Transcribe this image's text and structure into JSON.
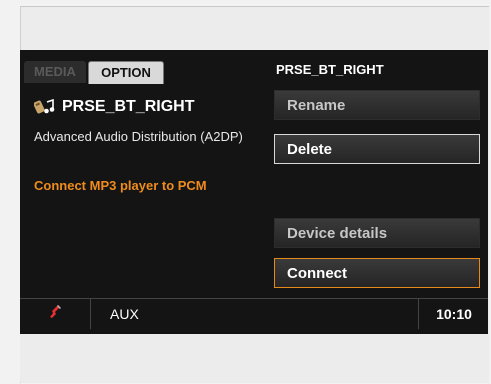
{
  "tabs": [
    {
      "label": "MEDIA",
      "active": false
    },
    {
      "label": "OPTION",
      "active": true
    }
  ],
  "header": {
    "title": "PRSE_BT_RIGHT"
  },
  "device": {
    "name": "PRSE_BT_RIGHT",
    "profile": "Advanced Audio Distribution (A2DP)",
    "icon": "bluetooth-audio-icon"
  },
  "message": {
    "text": "Connect MP3 player to PCM",
    "color": "#ef8c1c"
  },
  "buttons": {
    "rename": "Rename",
    "delete": "Delete",
    "device_details": "Device details",
    "connect": "Connect"
  },
  "status_bar": {
    "phone_icon": "phone-hangup-icon",
    "source": "AUX",
    "time": "10:10"
  },
  "colors": {
    "accent": "#ef8c1c",
    "screen_bg": "#141414"
  }
}
